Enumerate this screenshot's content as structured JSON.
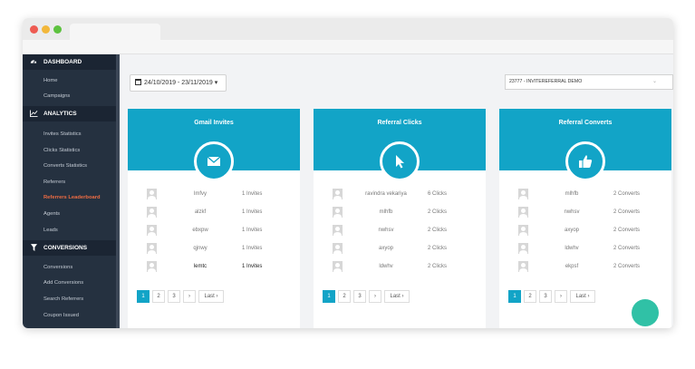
{
  "sidebar": {
    "sections": [
      {
        "title": "DASHBOARD",
        "icon": "dashboard-icon",
        "items": [
          "Home",
          "Campaigns"
        ]
      },
      {
        "title": "ANALYTICS",
        "icon": "chart-line-icon",
        "items": [
          "Invites Statistics",
          "Clicks Statistics",
          "Converts Statistics",
          "Referrers",
          "Referrers Leaderboard",
          "Agents",
          "Leads"
        ]
      },
      {
        "title": "CONVERSIONS",
        "icon": "filter-icon",
        "items": [
          "Conversions",
          "Add Conversions",
          "Search Referrers",
          "Coupon Issued"
        ]
      }
    ],
    "active_item": "Referrers Leaderboard"
  },
  "toolbar": {
    "date_range": "24/10/2019 - 23/11/2019",
    "campaign_select": "23777 - INVITEREFERRAL DEMO"
  },
  "cards": [
    {
      "title": "Gmail Invites",
      "icon": "envelope-icon",
      "rows": [
        {
          "name": "lmfvy",
          "count": "1 Invites"
        },
        {
          "name": "alzkf",
          "count": "1 Invites"
        },
        {
          "name": "ebxpw",
          "count": "1 Invites"
        },
        {
          "name": "qjnwy",
          "count": "1 Invites"
        },
        {
          "name": "lemtc",
          "count": "1 Invites"
        }
      ]
    },
    {
      "title": "Referral Clicks",
      "icon": "cursor-icon",
      "rows": [
        {
          "name": "ravindra vekariya",
          "count": "6 Clicks"
        },
        {
          "name": "mlhfb",
          "count": "2 Clicks"
        },
        {
          "name": "nwhsv",
          "count": "2 Clicks"
        },
        {
          "name": "axyop",
          "count": "2 Clicks"
        },
        {
          "name": "ldwhv",
          "count": "2 Clicks"
        }
      ]
    },
    {
      "title": "Referral Converts",
      "icon": "thumbs-up-icon",
      "rows": [
        {
          "name": "mlhfb",
          "count": "2 Converts"
        },
        {
          "name": "nwhsv",
          "count": "2 Converts"
        },
        {
          "name": "axyop",
          "count": "2 Converts"
        },
        {
          "name": "ldwhv",
          "count": "2 Converts"
        },
        {
          "name": "ekpsf",
          "count": "2 Converts"
        }
      ]
    }
  ],
  "pagination": {
    "pages": [
      "1",
      "2",
      "3"
    ],
    "next": "›",
    "last": "Last ›",
    "active_page": "1"
  },
  "colors": {
    "accent": "#12a4c7",
    "sidebar_bg": "#253140",
    "active_item": "#ef6c43"
  }
}
